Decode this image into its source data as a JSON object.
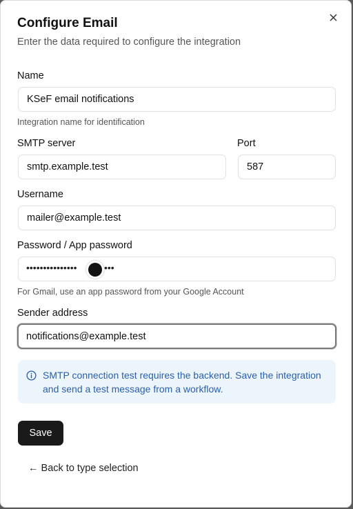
{
  "dialog": {
    "title": "Configure Email",
    "subtitle": "Enter the data required to configure the integration",
    "close_icon": "close-icon"
  },
  "form": {
    "name": {
      "label": "Name",
      "value": "KSeF email notifications",
      "help": "Integration name for identification"
    },
    "smtp_server": {
      "label": "SMTP server",
      "value": "smtp.example.test"
    },
    "port": {
      "label": "Port",
      "value": "587"
    },
    "username": {
      "label": "Username",
      "value": "mailer@example.test"
    },
    "password": {
      "label": "Password / App password",
      "masked_before": "•••••••••••••••",
      "masked_after": "•••",
      "help": "For Gmail, use an app password from your Google Account"
    },
    "sender": {
      "label": "Sender address",
      "value": "notifications@example.test"
    }
  },
  "info": {
    "icon": "info-icon",
    "text": "SMTP connection test requires the backend. Save the integration and send a test message from a workflow."
  },
  "actions": {
    "save_label": "Save",
    "back_label": "← Back to type selection"
  },
  "colors": {
    "info_bg": "#edf5fc",
    "info_text": "#2a5ea8",
    "primary_button": "#1a1a1a"
  }
}
